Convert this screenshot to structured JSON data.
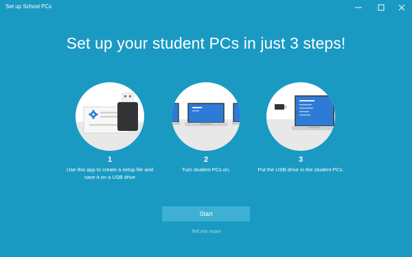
{
  "window": {
    "title": "Set up School PCs",
    "controls": [
      "minimize-icon",
      "maximize-icon",
      "close-icon"
    ]
  },
  "main": {
    "headline": "Set up your student PCs in just 3 steps!",
    "steps": [
      {
        "number": "1",
        "text": "Use this app to create a setup file and save it on a USB drive",
        "icon": "usb-drive-icon"
      },
      {
        "number": "2",
        "text": "Turn student PCs on.",
        "icon": "laptops-icon"
      },
      {
        "number": "3",
        "text": "Put the USB drive in the student PCs.",
        "icon": "laptop-usb-icon"
      }
    ],
    "start_label": "Start",
    "tell_more_label": "Tell me more"
  },
  "colors": {
    "background": "#1a9ac3",
    "button": "#3fb0d3",
    "screen_blue": "#2d7bd6",
    "link": "#a9dcee"
  }
}
